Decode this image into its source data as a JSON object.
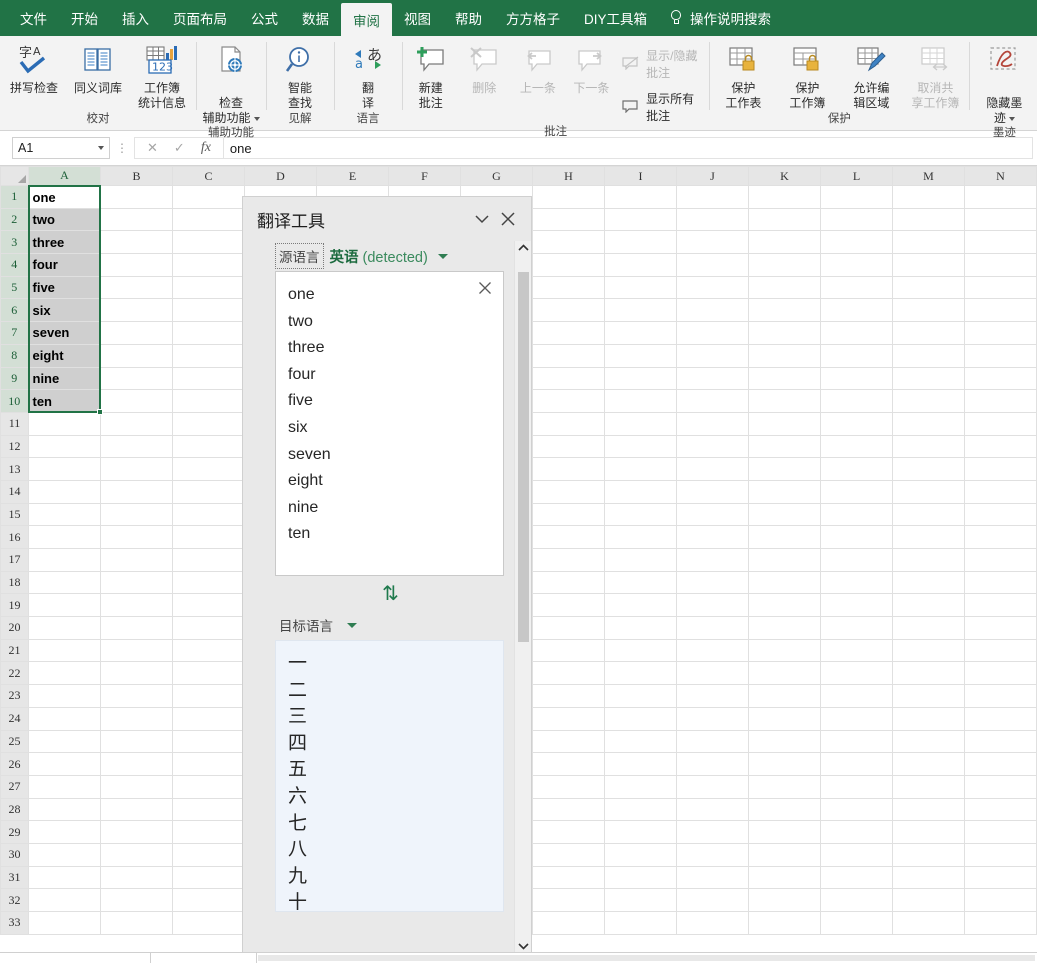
{
  "menubar": {
    "tabs": [
      {
        "label": "文件",
        "active": false
      },
      {
        "label": "开始",
        "active": false
      },
      {
        "label": "插入",
        "active": false
      },
      {
        "label": "页面布局",
        "active": false
      },
      {
        "label": "公式",
        "active": false
      },
      {
        "label": "数据",
        "active": false
      },
      {
        "label": "审阅",
        "active": true
      },
      {
        "label": "视图",
        "active": false
      },
      {
        "label": "帮助",
        "active": false
      },
      {
        "label": "方方格子",
        "active": false
      },
      {
        "label": "DIY工具箱",
        "active": false
      }
    ],
    "tell_me": "操作说明搜索",
    "bg_color": "#217346"
  },
  "ribbon": {
    "groups": [
      {
        "title": "校对",
        "buttons": [
          {
            "label": "拼写检查",
            "icon": "spelling-icon",
            "disabled": false
          },
          {
            "label": "同义词库",
            "icon": "thesaurus-icon",
            "disabled": false
          },
          {
            "label": "工作簿\n统计信息",
            "icon": "workbook-stats-icon",
            "disabled": false
          }
        ]
      },
      {
        "title": "辅助功能",
        "buttons": [
          {
            "label": "检查\n辅助功能",
            "icon": "check-accessibility-icon",
            "disabled": false,
            "has_caret": true
          }
        ]
      },
      {
        "title": "见解",
        "buttons": [
          {
            "label": "智能\n查找",
            "icon": "smart-lookup-icon",
            "disabled": false
          }
        ]
      },
      {
        "title": "语言",
        "buttons": [
          {
            "label": "翻\n译",
            "icon": "translate-icon",
            "disabled": false
          }
        ]
      },
      {
        "title": "批注",
        "buttons": [
          {
            "label": "新建\n批注",
            "icon": "new-comment-icon",
            "disabled": false
          },
          {
            "label": "删除",
            "icon": "delete-comment-icon",
            "disabled": true
          },
          {
            "label": "上一条",
            "icon": "previous-comment-icon",
            "disabled": true
          },
          {
            "label": "下一条",
            "icon": "next-comment-icon",
            "disabled": true
          }
        ],
        "small_buttons": [
          {
            "label": "显示/隐藏批注",
            "icon": "show-hide-comment-icon",
            "disabled": true
          },
          {
            "label": "显示所有批注",
            "icon": "show-all-comments-icon",
            "disabled": false
          }
        ]
      },
      {
        "title": "保护",
        "buttons": [
          {
            "label": "保护\n工作表",
            "icon": "protect-sheet-icon",
            "disabled": false
          },
          {
            "label": "保护\n工作簿",
            "icon": "protect-workbook-icon",
            "disabled": false
          },
          {
            "label": "允许编\n辑区域",
            "icon": "allow-edit-ranges-icon",
            "disabled": false
          },
          {
            "label": "取消共\n享工作簿",
            "icon": "unshare-workbook-icon",
            "disabled": true
          }
        ]
      },
      {
        "title": "墨迹",
        "buttons": [
          {
            "label": "隐藏墨\n迹",
            "icon": "hide-ink-icon",
            "disabled": false,
            "has_caret": true
          }
        ]
      }
    ]
  },
  "formula_bar": {
    "name_box_value": "A1",
    "cancel_icon": "cancel-icon",
    "confirm_icon": "confirm-icon",
    "fx_icon": "fx-icon",
    "value": "one"
  },
  "grid": {
    "columns": [
      "A",
      "B",
      "C",
      "D",
      "E",
      "F",
      "G",
      "H",
      "I",
      "J",
      "K",
      "L",
      "M",
      "N"
    ],
    "rows": [
      1,
      2,
      3,
      4,
      5,
      6,
      7,
      8,
      9,
      10,
      11,
      12,
      13,
      14,
      15,
      16,
      17,
      18,
      19,
      20,
      21,
      22,
      23,
      24,
      25,
      26,
      27,
      28,
      29,
      30,
      31,
      32,
      33
    ],
    "column_a_values": [
      "one",
      "two",
      "three",
      "four",
      "five",
      "six",
      "seven",
      "eight",
      "nine",
      "ten"
    ],
    "active_cell": "A1",
    "selection_range": "A1:A10",
    "selection_border_color": "#217346"
  },
  "translator_pane": {
    "title": "翻译工具",
    "collapse_icon": "chevron-down-icon",
    "close_icon": "close-icon",
    "source": {
      "label": "源语言",
      "detected_language": "英语",
      "detected_suffix": "(detected)",
      "dropdown_icon": "chevron-down-icon",
      "clear_icon": "clear-icon",
      "lines": [
        "one",
        "two",
        "three",
        "four",
        "five",
        "six",
        "seven",
        "eight",
        "nine",
        "ten"
      ]
    },
    "swap_icon": "swap-vertical-icon",
    "target": {
      "label": "目标语言",
      "dropdown_icon": "chevron-down-icon",
      "lines": [
        "一",
        "二",
        "三",
        "四",
        "五",
        "六",
        "七",
        "八",
        "九",
        "十"
      ],
      "background_color": "#eff4fb"
    },
    "scrollbar": {
      "up_icon": "chevron-up-icon",
      "down_icon": "chevron-down-icon"
    }
  }
}
